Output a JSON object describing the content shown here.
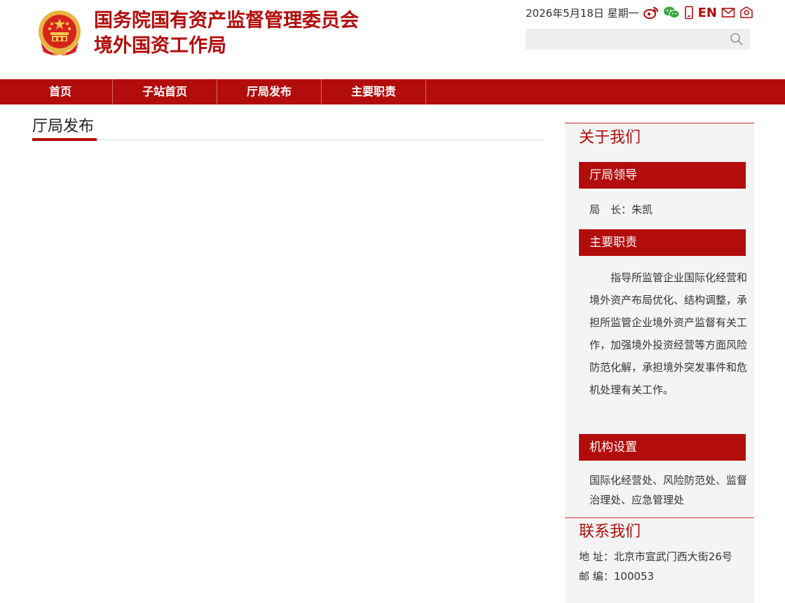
{
  "header": {
    "title_line1": "国务院国有资产监督管理委员会",
    "title_line2": "境外国资工作局",
    "date_text": "2026年5月18日 星期一",
    "en_label": "EN",
    "search_placeholder": "",
    "brand_color": "#b30c0c",
    "icons": [
      "weibo-icon",
      "wechat-icon",
      "mobile-icon",
      "mail-icon",
      "feedback-icon",
      "search-icon"
    ]
  },
  "nav": {
    "items": [
      "首页",
      "子站首页",
      "厅局发布",
      "主要职责"
    ]
  },
  "main": {
    "section_title": "厅局发布"
  },
  "sidebar": {
    "about_heading": "关于我们",
    "leaders_heading": "厅局领导",
    "leader_text": "局　长：朱凯",
    "duties_heading": "主要职责",
    "duties_text": "指导所监管企业国际化经营和境外资产布局优化、结构调整，承担所监管企业境外资产监督有关工作，加强境外投资经营等方面风险防范化解，承担境外突发事件和危机处理有关工作。",
    "org_heading": "机构设置",
    "org_text": "国际化经营处、风险防范处、监督治理处、应急管理处",
    "contact_heading": "联系我们",
    "address": "地 址：北京市宣武门西大街26号",
    "postcode": "邮 编：100053"
  }
}
